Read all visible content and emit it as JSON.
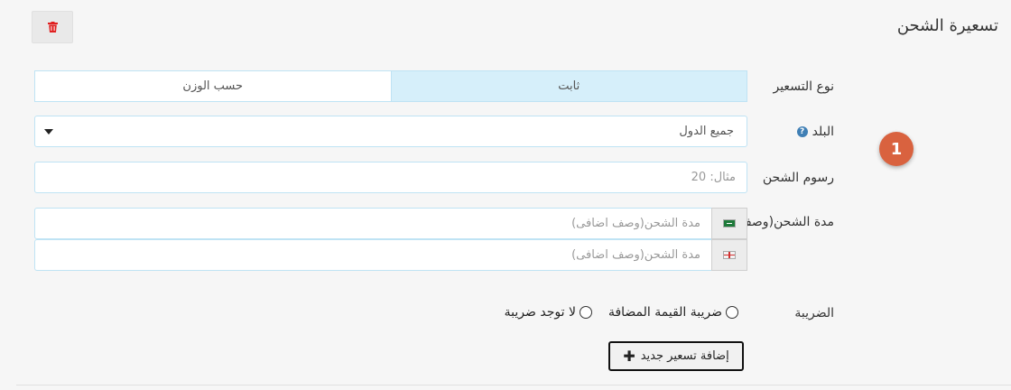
{
  "section": {
    "title": "تسعيرة الشحن"
  },
  "pricing_type": {
    "label": "نوع التسعير",
    "options": [
      "ثابت",
      "حسب الوزن"
    ],
    "selected": "ثابت"
  },
  "country": {
    "label": "البلد",
    "help_icon": "question-circle-icon",
    "value": "جميع الدول"
  },
  "shipping_fee": {
    "label": "رسوم الشحن",
    "placeholder": "مثال: 20"
  },
  "shipping_duration": {
    "label": "مدة الشحن(وصف اضافى)",
    "rows": [
      {
        "flag": "sa-flag-icon",
        "placeholder": "مدة الشحن(وصف اضافى)"
      },
      {
        "flag": "gb-flag-icon",
        "placeholder": "مدة الشحن(وصف اضافى)"
      }
    ]
  },
  "tax": {
    "label": "الضريبة",
    "options": [
      "ضريبة القيمة المضافة",
      "لا توجد ضريبة"
    ]
  },
  "step_badge": "1",
  "add_button": {
    "label": "إضافة تسعير جديد",
    "icon": "plus-icon"
  },
  "delete_button": {
    "icon": "trash-icon",
    "color": "#e02020"
  }
}
